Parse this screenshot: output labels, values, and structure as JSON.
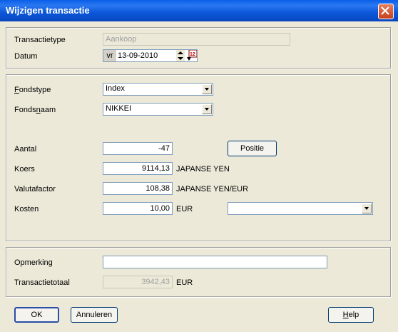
{
  "window": {
    "title": "Wijzigen transactie"
  },
  "section1": {
    "transactietype_label": "Transactietype",
    "transactietype_value": "Aankoop",
    "datum_label": "Datum",
    "datum_day": "vr",
    "datum_value": "13-09-2010"
  },
  "section2": {
    "fondstype_label": "Fondstype",
    "fondstype_value": "Index",
    "fondsnaam_label": "Fondsnaam",
    "fondsnaam_value": "NIKKEI",
    "aantal_label": "Aantal",
    "aantal_value": "-47",
    "positie_button": "Positie",
    "koers_label": "Koers",
    "koers_value": "9114,13",
    "koers_unit": "JAPANSE YEN",
    "valutafactor_label": "Valutafactor",
    "valutafactor_value": "108,38",
    "valutafactor_unit": "JAPANSE YEN/EUR",
    "kosten_label": "Kosten",
    "kosten_value": "10,00",
    "kosten_unit": "EUR",
    "kosten_combo_value": ""
  },
  "section3": {
    "opmerking_label": "Opmerking",
    "opmerking_value": "",
    "transactietotaal_label": "Transactietotaal",
    "transactietotaal_value": "3942,43",
    "transactietotaal_unit": "EUR"
  },
  "buttons": {
    "ok": "OK",
    "annuleren": "Annuleren",
    "help": "Help"
  },
  "colors": {
    "titlebar": "#0a5fe8",
    "face": "#ece9d8",
    "field_border": "#7f9db9"
  }
}
